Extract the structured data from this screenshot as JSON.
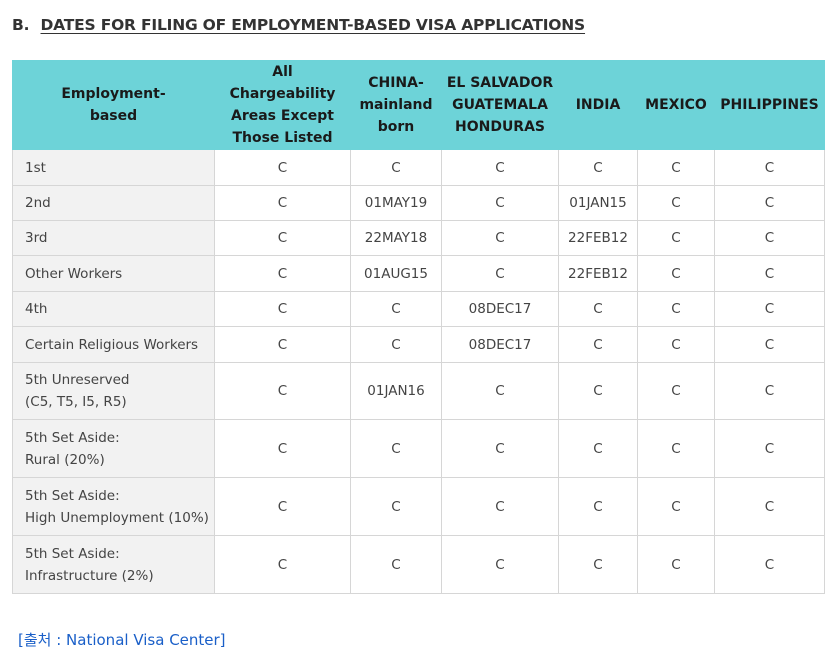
{
  "heading": {
    "prefix": "B.",
    "title": "DATES FOR FILING OF EMPLOYMENT-BASED VISA APPLICATIONS"
  },
  "table": {
    "columns": [
      "Employment-\nbased",
      "All Chargeability\nAreas Except\nThose Listed",
      "CHINA-\nmainland\nborn",
      "EL SALVADOR\nGUATEMALA\nHONDURAS",
      "INDIA",
      "MEXICO",
      "PHILIPPINES"
    ],
    "rows": [
      {
        "label": "1st",
        "values": [
          "C",
          "C",
          "C",
          "C",
          "C",
          "C"
        ]
      },
      {
        "label": "2nd",
        "values": [
          "C",
          "01MAY19",
          "C",
          "01JAN15",
          "C",
          "C"
        ]
      },
      {
        "label": "3rd",
        "values": [
          "C",
          "22MAY18",
          "C",
          "22FEB12",
          "C",
          "C"
        ]
      },
      {
        "label": "Other Workers",
        "values": [
          "C",
          "01AUG15",
          "C",
          "22FEB12",
          "C",
          "C"
        ]
      },
      {
        "label": "4th",
        "values": [
          "C",
          "C",
          "08DEC17",
          "C",
          "C",
          "C"
        ]
      },
      {
        "label": "Certain Religious Workers",
        "values": [
          "C",
          "C",
          "08DEC17",
          "C",
          "C",
          "C"
        ]
      },
      {
        "label": "5th Unreserved\n(C5, T5, I5, R5)",
        "values": [
          "C",
          "01JAN16",
          "C",
          "C",
          "C",
          "C"
        ]
      },
      {
        "label": "5th Set Aside:\nRural (20%)",
        "values": [
          "C",
          "C",
          "C",
          "C",
          "C",
          "C"
        ]
      },
      {
        "label": "5th Set Aside:\nHigh Unemployment (10%)",
        "values": [
          "C",
          "C",
          "C",
          "C",
          "C",
          "C"
        ]
      },
      {
        "label": "5th Set Aside:\nInfrastructure  (2%)",
        "values": [
          "C",
          "C",
          "C",
          "C",
          "C",
          "C"
        ]
      }
    ]
  },
  "source": "[출처 : National Visa Center]",
  "colors": {
    "header_bg": "#6dd3d8",
    "label_bg": "#f2f2f2",
    "link": "#1a5fc8"
  }
}
